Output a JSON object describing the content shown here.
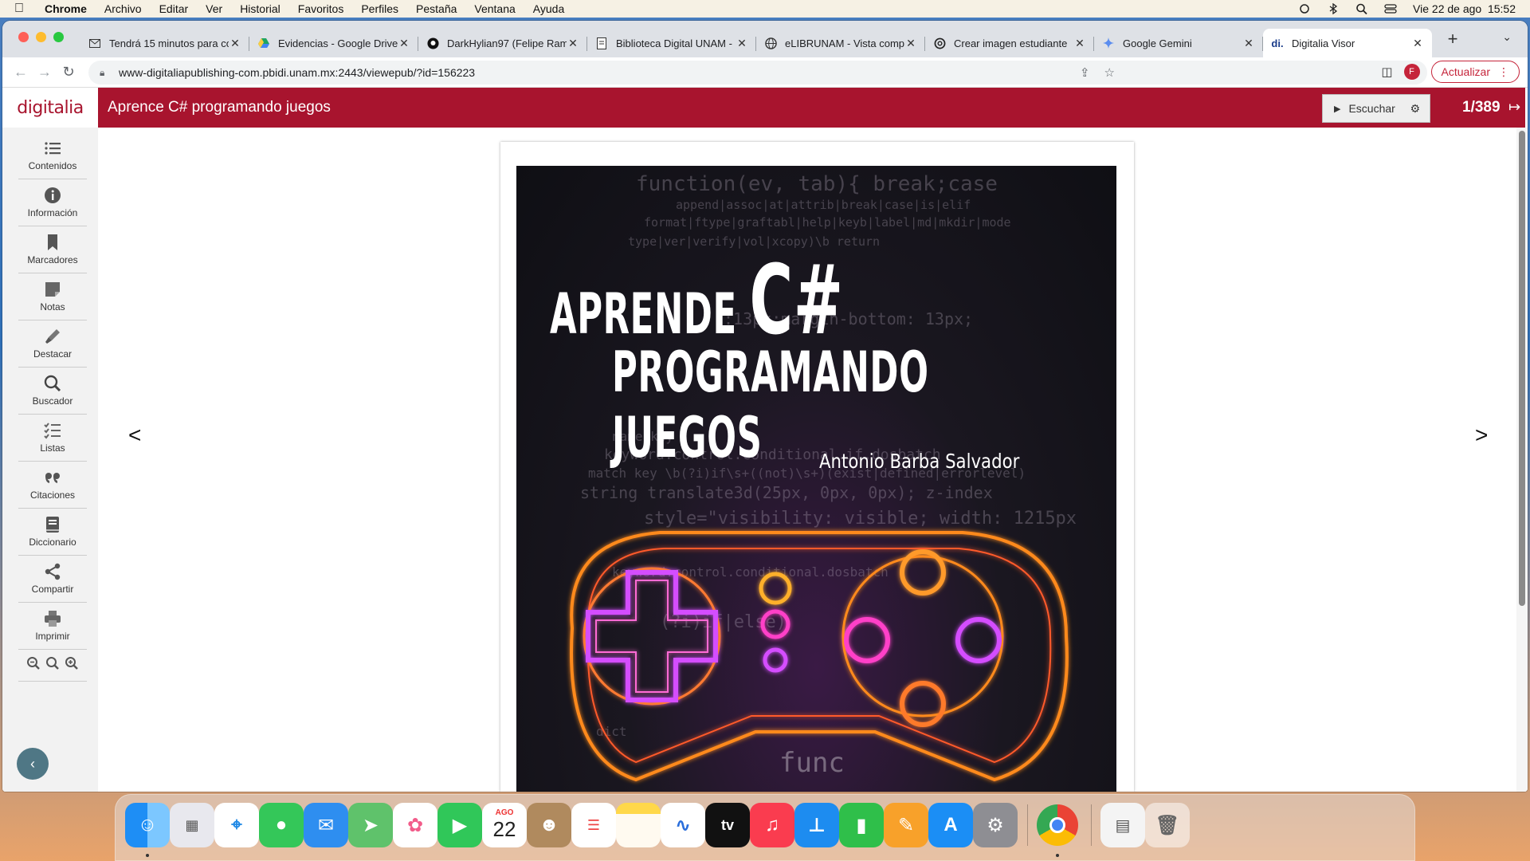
{
  "menubar": {
    "app": "Chrome",
    "items": [
      "Archivo",
      "Editar",
      "Ver",
      "Historial",
      "Favoritos",
      "Perfiles",
      "Pestaña",
      "Ventana",
      "Ayuda"
    ],
    "datetime": "Vie 22 de ago  15:52"
  },
  "browser": {
    "tabs": [
      {
        "label": "Tendrá 15 minutos para co",
        "icon": "mail-icon"
      },
      {
        "label": "Evidencias - Google Drive",
        "icon": "drive-icon"
      },
      {
        "label": "DarkHylian97 (Felipe Ram",
        "icon": "github-icon"
      },
      {
        "label": "Biblioteca Digital UNAM -",
        "icon": "doc-icon"
      },
      {
        "label": "eLIBRUNAM - Vista compl",
        "icon": "globe-icon"
      },
      {
        "label": "Crear imagen estudiante",
        "icon": "openai-icon"
      },
      {
        "label": "Google Gemini",
        "icon": "gemini-icon"
      },
      {
        "label": "Digitalia Visor",
        "icon": "digitalia-icon"
      }
    ],
    "active_tab_index": 7,
    "url": "www-digitaliapublishing-com.pbidi.unam.mx:2443/viewepub/?id=156223",
    "profile_initial": "F",
    "update_label": "Actualizar"
  },
  "viewer": {
    "logo": "digitalia",
    "book_title": "Aprence C# programando juegos",
    "listen_label": "Escuchar",
    "page_counter": "1/389",
    "prev_arrow": "<",
    "next_arrow": ">",
    "sidebar": [
      {
        "label": "Contenidos",
        "icon": "list-icon"
      },
      {
        "label": "Información",
        "icon": "info-icon"
      },
      {
        "label": "Marcadores",
        "icon": "bookmark-icon"
      },
      {
        "label": "Notas",
        "icon": "note-icon"
      },
      {
        "label": "Destacar",
        "icon": "highlighter-icon"
      },
      {
        "label": "Buscador",
        "icon": "search-icon"
      },
      {
        "label": "Listas",
        "icon": "checklist-icon"
      },
      {
        "label": "Citaciones",
        "icon": "quote-icon"
      },
      {
        "label": "Diccionario",
        "icon": "dictionary-icon"
      },
      {
        "label": "Compartir",
        "icon": "share-icon"
      },
      {
        "label": "Imprimir",
        "icon": "print-icon"
      }
    ],
    "cover": {
      "title_line1_prefix": "APRENDE",
      "title_line1_big": "C#",
      "title_line2": "PROGRAMANDO JUEGOS",
      "author": "Antonio Barba Salvador"
    }
  },
  "dock": {
    "apps": [
      "finder",
      "launchpad",
      "safari",
      "messages",
      "mail",
      "maps",
      "photos",
      "facetime",
      "calendar",
      "contacts",
      "reminders",
      "notes",
      "freeform",
      "tv",
      "music",
      "keynote",
      "numbers",
      "pages",
      "app-store",
      "system-settings",
      "chrome",
      "preview",
      "trash"
    ],
    "calendar_month": "AGO",
    "calendar_day": "22"
  },
  "colors": {
    "brand": "#a8142e",
    "sidebar_bg": "#f2f2f2",
    "collapse_btn": "#4f7785"
  }
}
